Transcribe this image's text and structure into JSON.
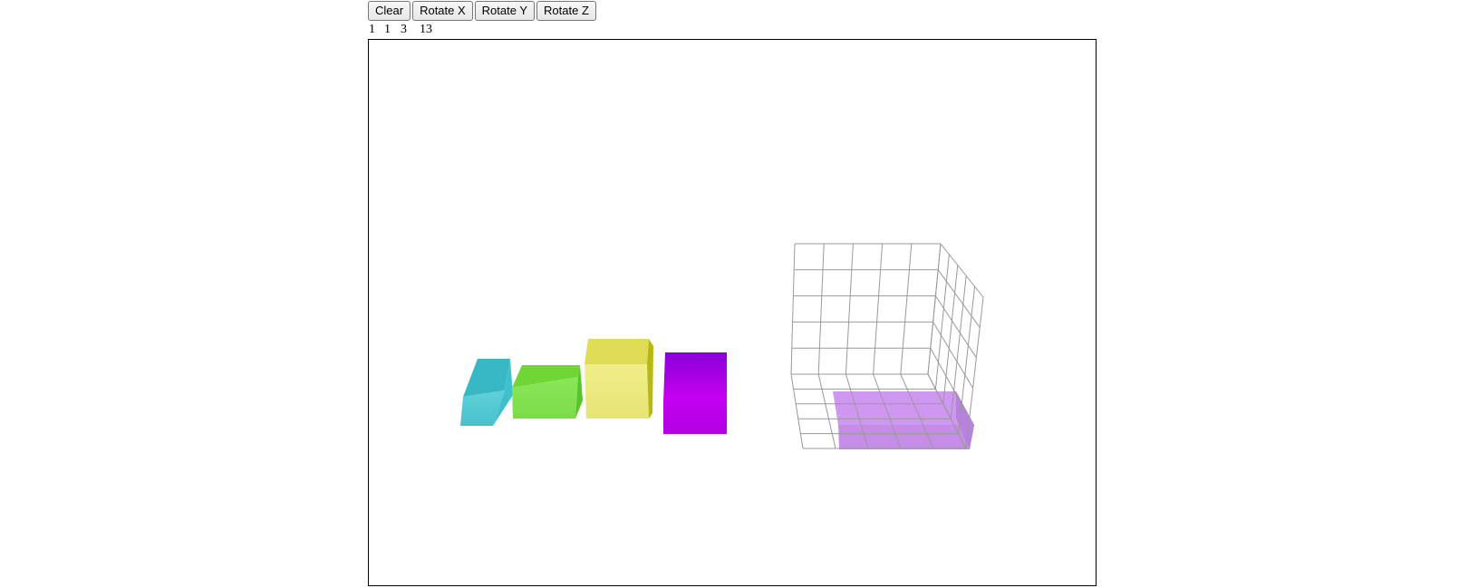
{
  "toolbar": {
    "clear_label": "Clear",
    "rotate_x_label": "Rotate X",
    "rotate_y_label": "Rotate Y",
    "rotate_z_label": "Rotate Z"
  },
  "counters": [
    "1",
    "1",
    "3",
    "13"
  ],
  "colors": {
    "cyan_piece": "#4cc6d0",
    "green_piece": "#7ee04a",
    "yellow_piece": "#ece97a",
    "purple_piece": "#b400e6",
    "placed_block": "#b46ee6",
    "grid_line": "#999999",
    "canvas_border": "#000000"
  },
  "grid": {
    "columns": 5,
    "rows": 5,
    "depth": 5
  }
}
